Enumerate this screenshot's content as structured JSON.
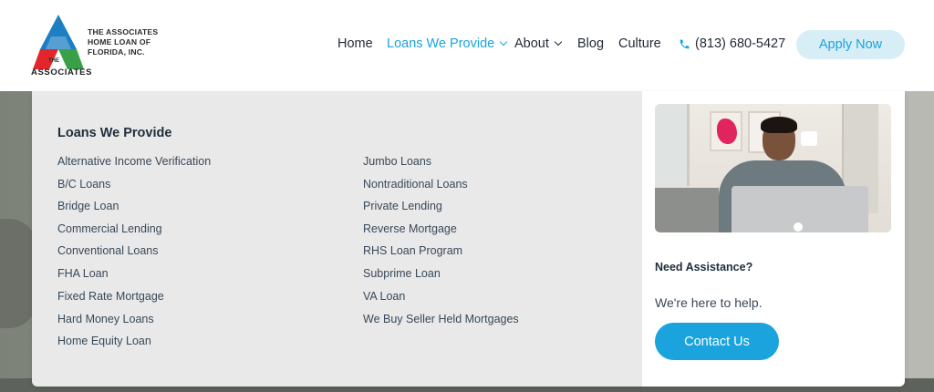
{
  "logo": {
    "company_lines": "THE ASSOCIATES HOME LOAN OF FLORIDA, INC.",
    "mark_small": "THE",
    "mark_large": "ASSOCIATES",
    "colors": {
      "blue": "#1c7fc4",
      "red": "#e3262c",
      "green": "#3aa048"
    }
  },
  "nav": {
    "home": "Home",
    "loans": "Loans We Provide",
    "about": "About",
    "blog": "Blog",
    "culture": "Culture",
    "phone": "(813) 680-5427",
    "apply": "Apply Now"
  },
  "menu": {
    "title": "Loans We Provide",
    "col1": [
      "Alternative Income Verification",
      "B/C Loans",
      "Bridge Loan",
      "Commercial Lending",
      "Conventional Loans",
      "FHA Loan",
      "Fixed Rate Mortgage",
      "Hard Money Loans",
      "Home Equity Loan"
    ],
    "col2": [
      "Jumbo Loans",
      "Nontraditional Loans",
      "Private Lending",
      "Reverse Mortgage",
      "RHS Loan Program",
      "Subprime Loan",
      "VA Loan",
      "We Buy Seller Held Mortgages"
    ]
  },
  "assist": {
    "title": "Need Assistance?",
    "subtitle": "We're here to help.",
    "button": "Contact Us"
  },
  "colors": {
    "accent": "#1aa3dc",
    "apply_bg": "#d8eef7",
    "panel_bg": "#e8e9e8"
  }
}
